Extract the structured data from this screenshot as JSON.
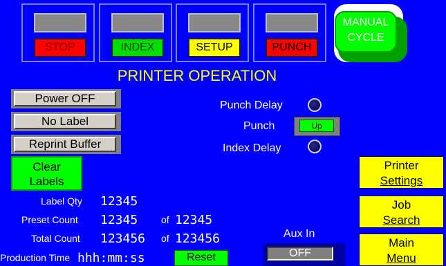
{
  "mode_buttons": {
    "stop": "STOP",
    "index": "INDEX",
    "setup": "SETUP",
    "punch": "PUNCH"
  },
  "manual_cycle": {
    "line1": "MANUAL",
    "line2": "CYCLE"
  },
  "title": "PRINTER OPERATION",
  "left_buttons": {
    "power": "Power OFF",
    "label": "No Label",
    "reprint": "Reprint Buffer",
    "clear_line1": "Clear",
    "clear_line2": "Labels"
  },
  "status": {
    "punch_delay": "Punch Delay",
    "punch": "Punch",
    "punch_state": "Up",
    "index_delay": "Index Delay"
  },
  "counts": {
    "label_qty_label": "Label Qty",
    "label_qty_value": "12345",
    "preset_label": "Preset Count",
    "preset_value": "12345",
    "preset_of": "of",
    "preset_total": "12345",
    "total_label": "Total Count",
    "total_value": "123456",
    "total_of": "of",
    "total_total": "123456",
    "production_label": "Production Time",
    "production_value": "hhh:mm:ss",
    "reset": "Reset"
  },
  "aux": {
    "label": "Aux In",
    "state": "OFF"
  },
  "right_buttons": {
    "printer_line1": "Printer",
    "printer_line2": "Settings",
    "job_line1": "Job",
    "job_line2": "Search",
    "main_line1": "Main",
    "main_line2": "Menu"
  }
}
